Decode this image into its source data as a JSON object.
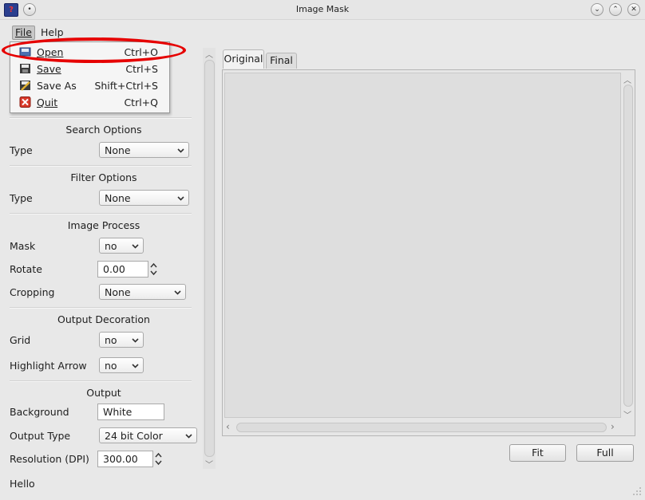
{
  "window": {
    "title": "Image Mask"
  },
  "menubar": {
    "file": "File",
    "help": "Help"
  },
  "file_menu": {
    "items": [
      {
        "label": "Open",
        "shortcut": "Ctrl+O",
        "icon": "open-icon"
      },
      {
        "label": "Save",
        "shortcut": "Ctrl+S",
        "icon": "save-icon"
      },
      {
        "label": "Save As",
        "shortcut": "Shift+Ctrl+S",
        "icon": "save-as-icon"
      },
      {
        "label": "Quit",
        "shortcut": "Ctrl+Q",
        "icon": "quit-icon"
      }
    ]
  },
  "search_options": {
    "title": "Search Options",
    "type_label": "Type",
    "type_value": "None"
  },
  "filter_options": {
    "title": "Filter Options",
    "type_label": "Type",
    "type_value": "None"
  },
  "image_process": {
    "title": "Image Process",
    "mask_label": "Mask",
    "mask_value": "no",
    "rotate_label": "Rotate",
    "rotate_value": "0.00",
    "cropping_label": "Cropping",
    "cropping_value": "None"
  },
  "output_decoration": {
    "title": "Output Decoration",
    "grid_label": "Grid",
    "grid_value": "no",
    "highlight_label": "Highlight Arrow",
    "highlight_value": "no"
  },
  "output": {
    "title": "Output",
    "background_label": "Background",
    "background_value": "White",
    "type_label": "Output Type",
    "type_value": "24 bit Color",
    "resolution_label": "Resolution (DPI)",
    "resolution_value": "300.00"
  },
  "tabs": {
    "original": "Original",
    "final": "Final"
  },
  "buttons": {
    "fit": "Fit",
    "full": "Full"
  },
  "status": {
    "text": "Hello"
  },
  "colors": {
    "annotation": "#e60000",
    "background": "#e8e8e8"
  }
}
